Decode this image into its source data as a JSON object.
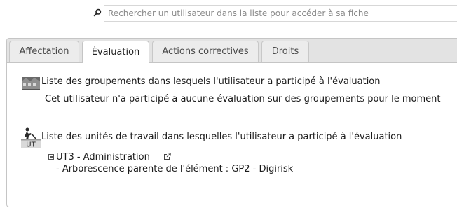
{
  "search": {
    "placeholder": "Rechercher un utilisateur dans la liste pour accéder à sa fiche",
    "value": ""
  },
  "tabs": [
    {
      "label": "Affectation",
      "active": false
    },
    {
      "label": "Évaluation",
      "active": true
    },
    {
      "label": "Actions correctives",
      "active": false
    },
    {
      "label": "Droits",
      "active": false
    }
  ],
  "groupements": {
    "title": "Liste des groupements dans lesquels l'utilisateur a participé à l'évaluation",
    "empty_message": "Cet utilisateur n'a participé a aucune évaluation sur des groupements pour le moment"
  },
  "unites": {
    "title": "Liste des unités de travail dans lesquelles l'utilisateur a participé à l'évaluation",
    "icon_label": "UT",
    "items": [
      {
        "name": "UT3 - Administration",
        "parent": "- Arborescence parente de l'élément : GP2 - Digirisk"
      }
    ]
  }
}
